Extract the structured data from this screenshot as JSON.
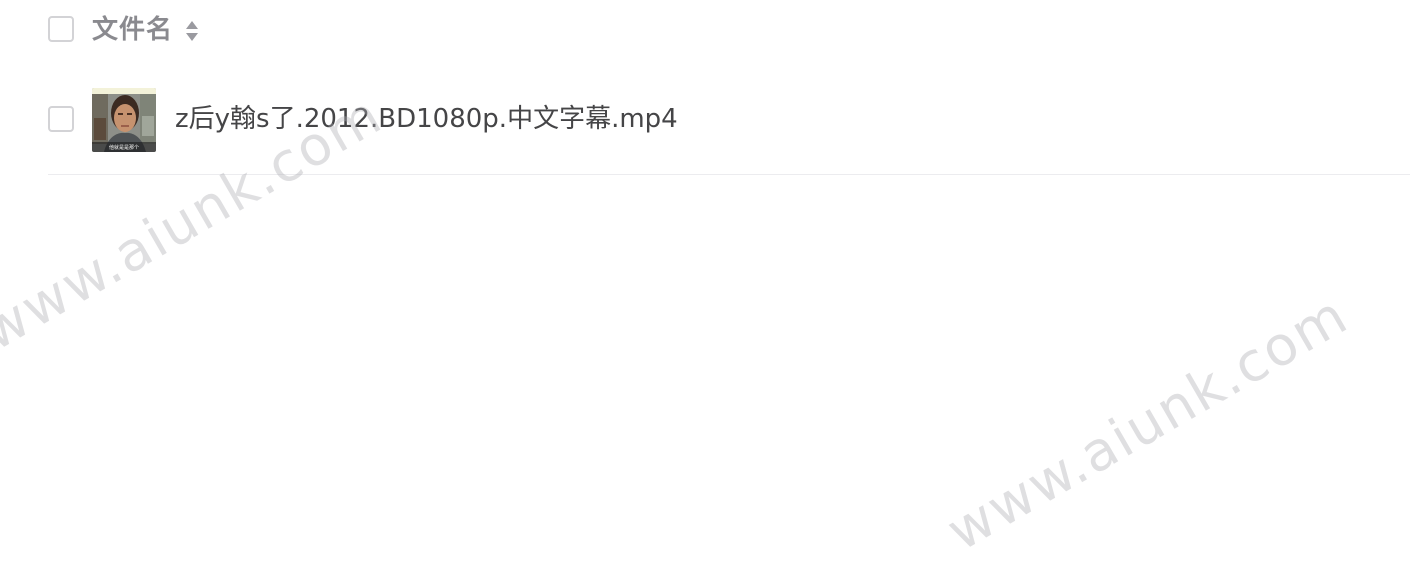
{
  "file_list": {
    "header": {
      "column_label": "文件名",
      "sort_icon": "sort-both-icon"
    },
    "rows": [
      {
        "name": "z后y翰s了.2012.BD1080p.中文字幕.mp4",
        "thumbnail": "video-thumbnail",
        "thumbnail_caption": "他就是是那个",
        "checked": false
      }
    ]
  },
  "watermarks": [
    "www.aiunk.com",
    "www.aiunk.com"
  ],
  "colors": {
    "header_text": "#8a8a8f",
    "row_text": "#454547",
    "checkbox_border": "#d3d3d6",
    "divider": "#ececef"
  }
}
